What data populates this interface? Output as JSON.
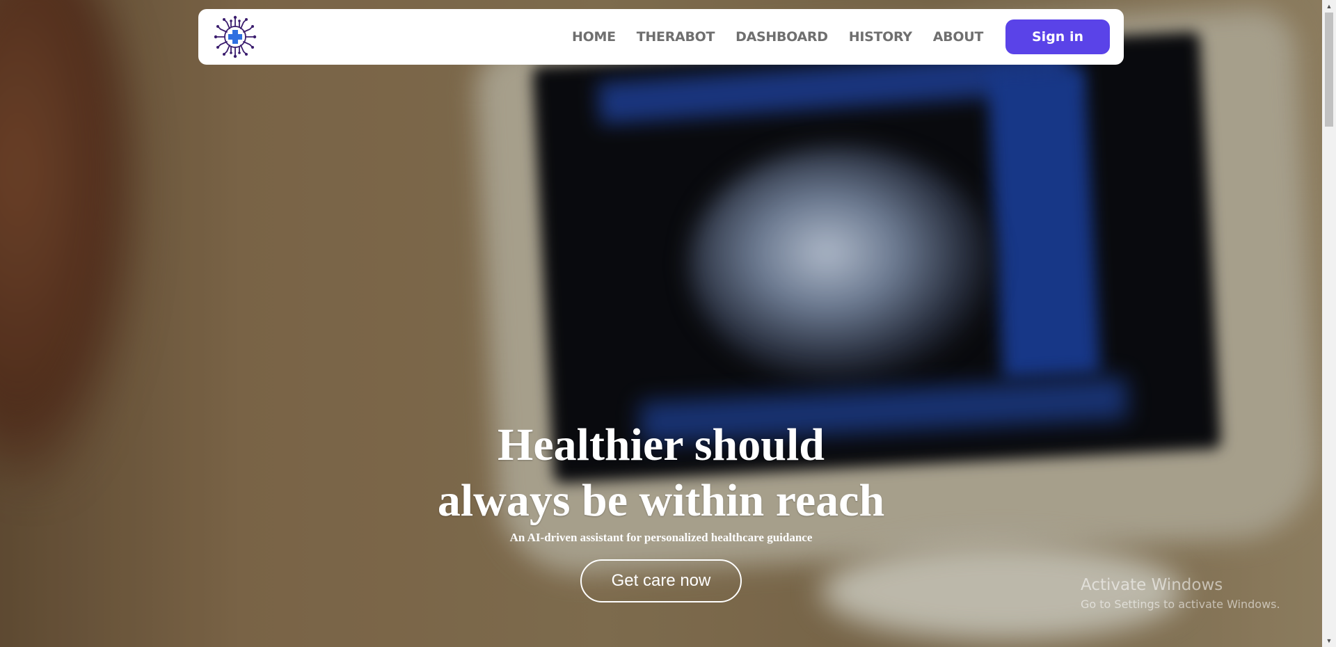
{
  "nav": {
    "logo_icon": "medical-cross-circuit-logo",
    "links": [
      "HOME",
      "THERABOT",
      "DASHBOARD",
      "HISTORY",
      "ABOUT"
    ],
    "sign_in_label": "Sign in"
  },
  "hero": {
    "title_line1": "Healthier should",
    "title_line2": "always be within reach",
    "subtitle": "An AI-driven assistant for personalized healthcare guidance",
    "cta_label": "Get care now"
  },
  "watermark": {
    "title": "Activate Windows",
    "subtitle": "Go to Settings to activate Windows."
  },
  "colors": {
    "accent": "#5a43e8",
    "nav_text": "#6f6f6f",
    "logo_purple": "#3b1d6e",
    "logo_blue": "#2f6fe0"
  }
}
